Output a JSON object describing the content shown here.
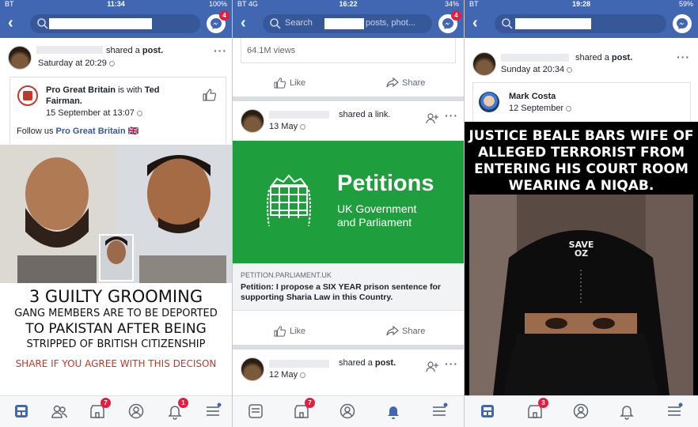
{
  "colors": {
    "brand": "#4267b2",
    "petitions_green": "#1e9e3c",
    "badge_red": "#e41e3f",
    "link_blue": "#365899"
  },
  "panel1": {
    "status": {
      "carrier": "BT",
      "time": "11:34",
      "battery": "100%"
    },
    "search_badge": "4",
    "post": {
      "verb": "shared a",
      "object": "post.",
      "time": "Saturday at 20:29"
    },
    "shared": {
      "page": "Pro Great Britain",
      "with": "is with",
      "tagged": "Ted",
      "tagged2": "Fairman.",
      "time": "15 September at 13:07",
      "caption_prefix": "Follow us",
      "caption_page": "Pro Great Britain",
      "flag": "🇬🇧"
    },
    "meme": {
      "line1": "3 GUILTY GROOMING",
      "line2": "GANG MEMBERS ARE TO BE DEPORTED",
      "line3": "TO PAKISTAN AFTER BEING",
      "line4": "STRIPPED OF BRITISH CITIZENSHIP",
      "line5": "SHARE IF YOU AGREE WITH THIS DECISON"
    },
    "tabs": {
      "marketplace_badge": "7",
      "notifications_badge": "1"
    }
  },
  "panel2": {
    "status": {
      "carrier": "BT",
      "network": "4G",
      "time": "16:22",
      "battery": "34%"
    },
    "search_placeholder": "Search",
    "search_placeholder_tail": "posts, phot...",
    "search_badge": "4",
    "views": "64.1M views",
    "like": "Like",
    "share": "Share",
    "post1": {
      "verb": "shared a",
      "object": "link.",
      "time": "13 May"
    },
    "petitions": {
      "title": "Petitions",
      "sub1": "UK Government",
      "sub2": "and Parliament",
      "domain": "PETITION.PARLIAMENT.UK",
      "headline": "Petition: I propose a SIX YEAR prison sentence for supporting Sharia Law in this Country."
    },
    "like2": "Like",
    "share2": "Share",
    "post2": {
      "verb": "shared a",
      "object": "post.",
      "time": "12 May"
    },
    "tabs": {
      "marketplace_badge": "7"
    }
  },
  "panel3": {
    "status": {
      "carrier": "BT",
      "time": "19:28",
      "battery": "59%"
    },
    "post": {
      "verb": "shared a",
      "object": "post.",
      "time": "Sunday at 20:34"
    },
    "shared": {
      "name": "Mark Costa",
      "time": "12 September"
    },
    "meme": {
      "line1": "JUSTICE BEALE  BARS WIFE OF",
      "line2": "ALLEGED TERRORIST FROM",
      "line3": "ENTERING HIS COURT ROOM",
      "line4": "WEARING A NIQAB.",
      "cap_line1": "SAVE",
      "cap_line2": "OZ"
    },
    "tabs": {
      "marketplace_badge": "3"
    }
  }
}
